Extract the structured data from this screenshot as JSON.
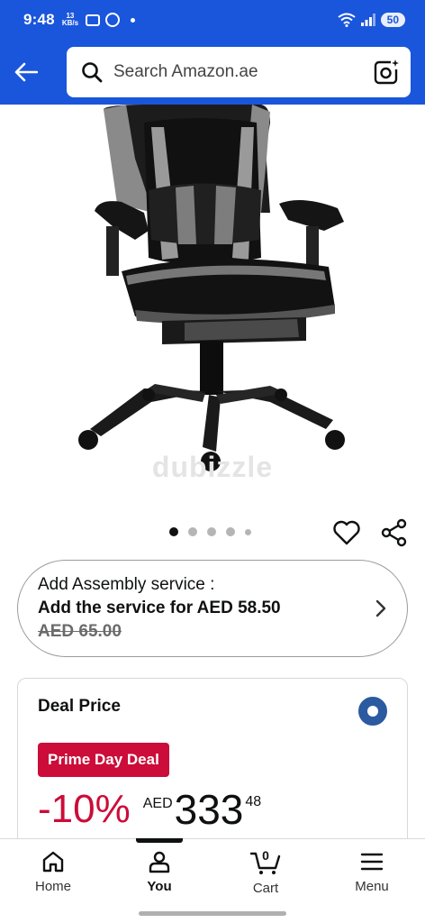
{
  "status": {
    "time": "9:48",
    "net_speed": "13",
    "net_unit": "KB/s",
    "battery": "50"
  },
  "search": {
    "placeholder": "Search Amazon.ae"
  },
  "product": {
    "watermark": "dubizzle",
    "image_count": 5,
    "active_image": 1
  },
  "assembly": {
    "title": "Add Assembly service :",
    "offer": "Add the service for  AED 58.50",
    "old_price": "AED 65.00"
  },
  "deal": {
    "title": "Deal Price",
    "badge": "Prime Day Deal",
    "discount": "-10%",
    "currency": "AED",
    "price_whole": "333",
    "price_fraction": "48",
    "selected": true
  },
  "nav": {
    "home": "Home",
    "you": "You",
    "cart": "Cart",
    "cart_count": "0",
    "menu": "Menu"
  },
  "colors": {
    "header_blue": "#1a56db",
    "deal_red": "#cc0c39",
    "radio_blue": "#2c5aa0"
  }
}
